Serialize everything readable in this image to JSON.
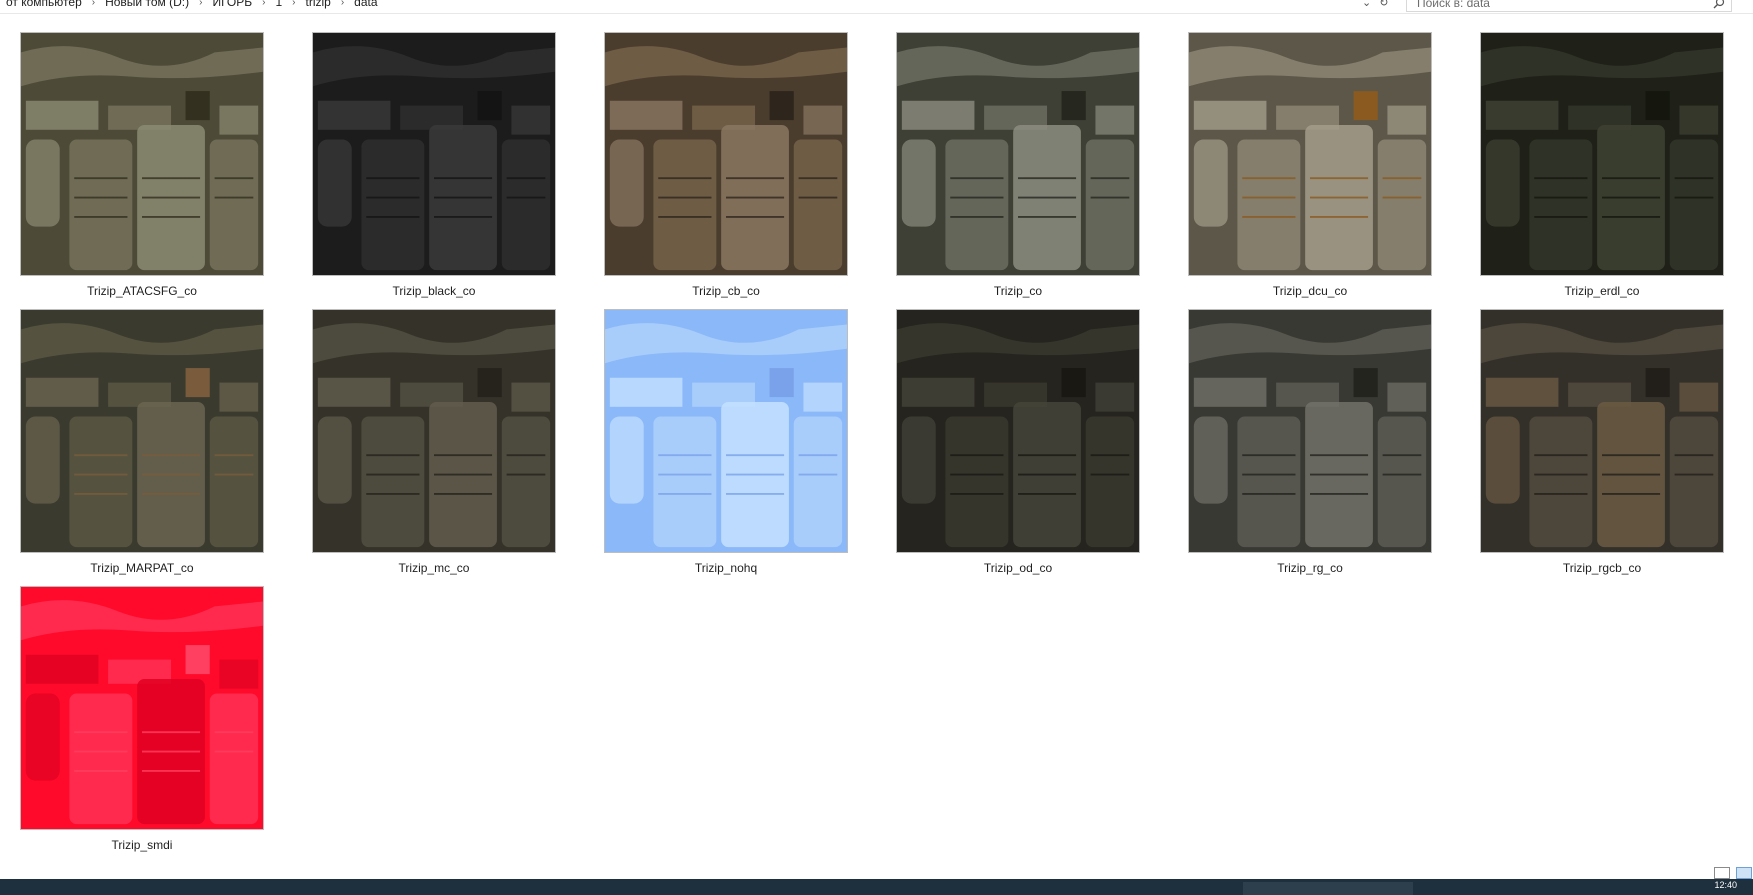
{
  "breadcrumb": [
    "от компьютер",
    "Новый том (D:)",
    "ИГОРЬ",
    "1",
    "trizip",
    "data"
  ],
  "search": {
    "placeholder": "Поиск в: data"
  },
  "files": [
    {
      "name": "Trizip_ATACSFG_co",
      "colors": [
        "#4d4a38",
        "#6f6b55",
        "#8b8a72",
        "#33301f"
      ]
    },
    {
      "name": "Trizip_black_co",
      "colors": [
        "#1c1c1c",
        "#2b2b2b",
        "#3a3a3a",
        "#141414"
      ]
    },
    {
      "name": "Trizip_cb_co",
      "colors": [
        "#4a3d2d",
        "#6e5c45",
        "#8a7762",
        "#2e261c"
      ]
    },
    {
      "name": "Trizip_co",
      "colors": [
        "#3e3f35",
        "#65665a",
        "#8c8d80",
        "#26271f"
      ]
    },
    {
      "name": "Trizip_dcu_co",
      "colors": [
        "#5c5749",
        "#857e6c",
        "#a39c8a",
        "#8a5a20"
      ]
    },
    {
      "name": "Trizip_erdl_co",
      "colors": [
        "#1f2119",
        "#2f3226",
        "#3e4233",
        "#15170f"
      ]
    },
    {
      "name": "Trizip_MARPAT_co",
      "colors": [
        "#3a3a2e",
        "#55533f",
        "#6b6550",
        "#7a5c3d"
      ]
    },
    {
      "name": "Trizip_mc_co",
      "colors": [
        "#35322a",
        "#4d4a3e",
        "#615c4d",
        "#25231c"
      ]
    },
    {
      "name": "Trizip_nohq",
      "colors": [
        "#8ab8f8",
        "#a8cdfb",
        "#c4e0ff",
        "#7aa2ea"
      ]
    },
    {
      "name": "Trizip_od_co",
      "colors": [
        "#25241e",
        "#36352c",
        "#45443a",
        "#191813"
      ]
    },
    {
      "name": "Trizip_rg_co",
      "colors": [
        "#393934",
        "#56564f",
        "#727168",
        "#24241f"
      ]
    },
    {
      "name": "Trizip_rgcb_co",
      "colors": [
        "#33302a",
        "#4d463b",
        "#6b5a43",
        "#221f1a"
      ]
    },
    {
      "name": "Trizip_smdi",
      "colors": [
        "#ff0a2a",
        "#ff2a4e",
        "#e00022",
        "#ff4060"
      ]
    }
  ],
  "taskbar": {
    "clock": "12:40"
  }
}
